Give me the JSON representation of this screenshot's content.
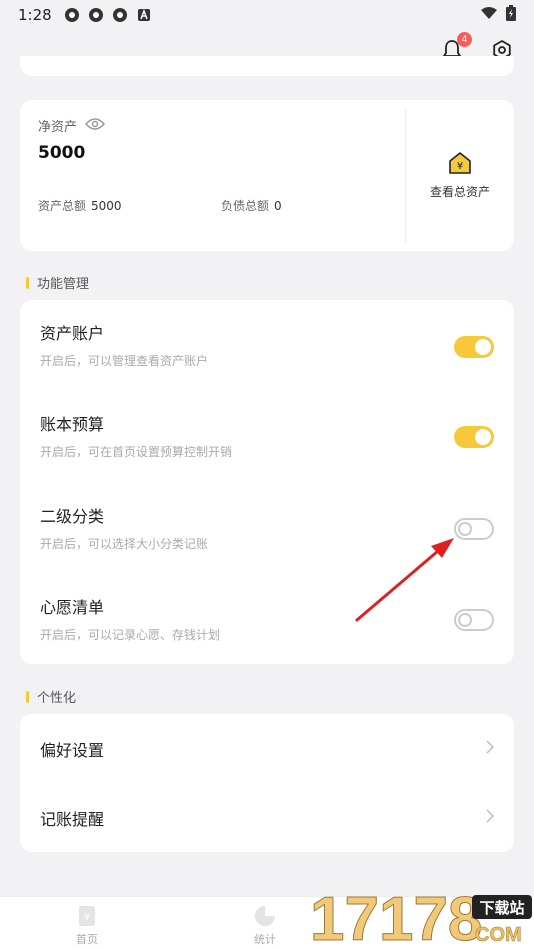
{
  "status": {
    "time": "1:28"
  },
  "topbar": {
    "notification_count": "4"
  },
  "assets": {
    "net_label": "净资产",
    "net_value": "5000",
    "total_assets_label": "资产总额",
    "total_assets_value": "5000",
    "total_debt_label": "负债总额",
    "total_debt_value": "0",
    "view_all_label": "查看总资产"
  },
  "features": {
    "section_title": "功能管理",
    "items": [
      {
        "title": "资产账户",
        "desc": "开启后，可以管理查看资产账户",
        "enabled": true
      },
      {
        "title": "账本预算",
        "desc": "开启后，可在首页设置预算控制开销",
        "enabled": true
      },
      {
        "title": "二级分类",
        "desc": "开启后，可以选择大小分类记账",
        "enabled": false
      },
      {
        "title": "心愿清单",
        "desc": "开启后，可以记录心愿、存钱计划",
        "enabled": false
      }
    ]
  },
  "personal": {
    "section_title": "个性化",
    "items": [
      {
        "label": "偏好设置"
      },
      {
        "label": "记账提醒"
      }
    ]
  },
  "tabs": [
    {
      "label": "首页"
    },
    {
      "label": "统计"
    }
  ],
  "watermark": {
    "digits": "17178",
    "brand": "下载站",
    "domain": "COM"
  },
  "colors": {
    "accent": "#f5c93a",
    "badge": "#ff5a5a",
    "arrow": "#e02020"
  }
}
